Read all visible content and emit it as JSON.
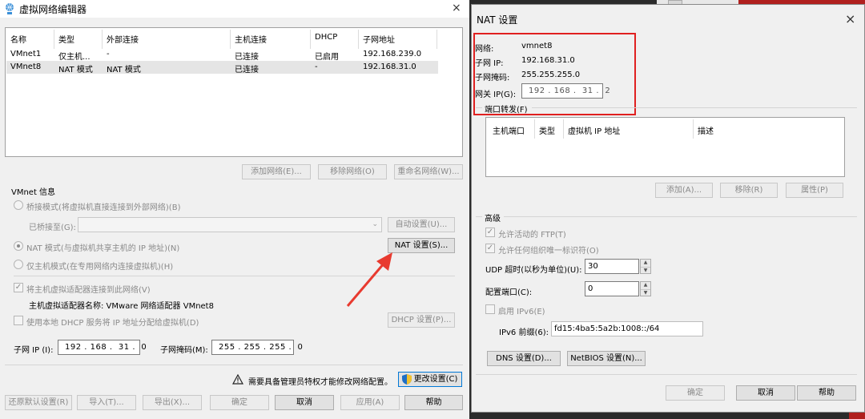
{
  "left_window": {
    "title": "虚拟网络编辑器",
    "close_symbol": "×",
    "table": {
      "headers": [
        "名称",
        "类型",
        "外部连接",
        "主机连接",
        "DHCP",
        "子网地址"
      ],
      "rows": [
        {
          "name": "VMnet1",
          "type": "仅主机...",
          "ext": "-",
          "host": "已连接",
          "dhcp": "已启用",
          "subnet": "192.168.239.0"
        },
        {
          "name": "VMnet8",
          "type": "NAT 模式",
          "ext": "NAT 模式",
          "host": "已连接",
          "dhcp": "-",
          "subnet": "192.168.31.0"
        }
      ]
    },
    "list_buttons": {
      "add": "添加网络(E)...",
      "remove": "移除网络(O)",
      "rename": "重命名网络(W)..."
    },
    "vmnet_info": {
      "group_title": "VMnet 信息",
      "bridge_radio": "桥接模式(将虚拟机直接连接到外部网络)(B)",
      "bridged_to_label": "已桥接至(G):",
      "auto_settings": "自动设置(U)...",
      "nat_radio": "NAT 模式(与虚拟机共享主机的 IP 地址)(N)",
      "nat_settings": "NAT 设置(S)...",
      "hostonly_radio": "仅主机模式(在专用网络内连接虚拟机)(H)",
      "connect_adapter_check": "将主机虚拟适配器连接到此网络(V)",
      "adapter_name": "主机虚拟适配器名称: VMware 网络适配器 VMnet8",
      "dhcp_check": "使用本地 DHCP 服务将 IP 地址分配给虚拟机(D)",
      "dhcp_settings": "DHCP 设置(P)...",
      "subnet_ip_label": "子网 IP (I):",
      "subnet_ip": "192 . 168 .  31 .  0",
      "subnet_mask_label": "子网掩码(M):",
      "subnet_mask": "255 . 255 . 255 .  0"
    },
    "admin_warning": "需要具备管理员特权才能修改网络配置。",
    "change_settings": "更改设置(C)",
    "bottom_buttons": {
      "restore": "还原默认设置(R)",
      "import": "导入(T)...",
      "export": "导出(X)...",
      "ok": "确定",
      "cancel": "取消",
      "apply": "应用(A)",
      "help": "帮助"
    }
  },
  "nat_dialog": {
    "title": "NAT 设置",
    "close_symbol": "×",
    "network_label": "网络:",
    "network_value": "vmnet8",
    "subnet_ip_label": "子网 IP:",
    "subnet_ip_value": "192.168.31.0",
    "subnet_mask_label": "子网掩码:",
    "subnet_mask_value": "255.255.255.0",
    "gateway_label": "网关 IP(G):",
    "gateway_value": "192 . 168 .  31 .  2",
    "port_forward_title": "端口转发(F)",
    "port_headers": [
      "主机端口",
      "类型",
      "虚拟机 IP 地址",
      "描述"
    ],
    "port_buttons": {
      "add": "添加(A)...",
      "remove": "移除(R)",
      "props": "属性(P)"
    },
    "advanced_title": "高级",
    "allow_ftp": "允许活动的 FTP(T)",
    "allow_oui": "允许任何组织唯一标识符(O)",
    "udp_timeout_label": "UDP 超时(以秒为单位)(U):",
    "udp_timeout_value": "30",
    "config_port_label": "配置端口(C):",
    "config_port_value": "0",
    "ipv6_check": "启用 IPv6(E)",
    "ipv6_prefix_label": "IPv6 前缀(6):",
    "ipv6_prefix_value": "fd15:4ba5:5a2b:1008::/64",
    "dns_settings": "DNS 设置(D)...",
    "netbios_settings": "NetBIOS 设置(N)...",
    "ok": "确定",
    "cancel": "取消",
    "help": "帮助"
  },
  "colors": {
    "highlight": "#e02020",
    "arrow": "#e83a2f",
    "selected_row": "#e5e5e5"
  }
}
